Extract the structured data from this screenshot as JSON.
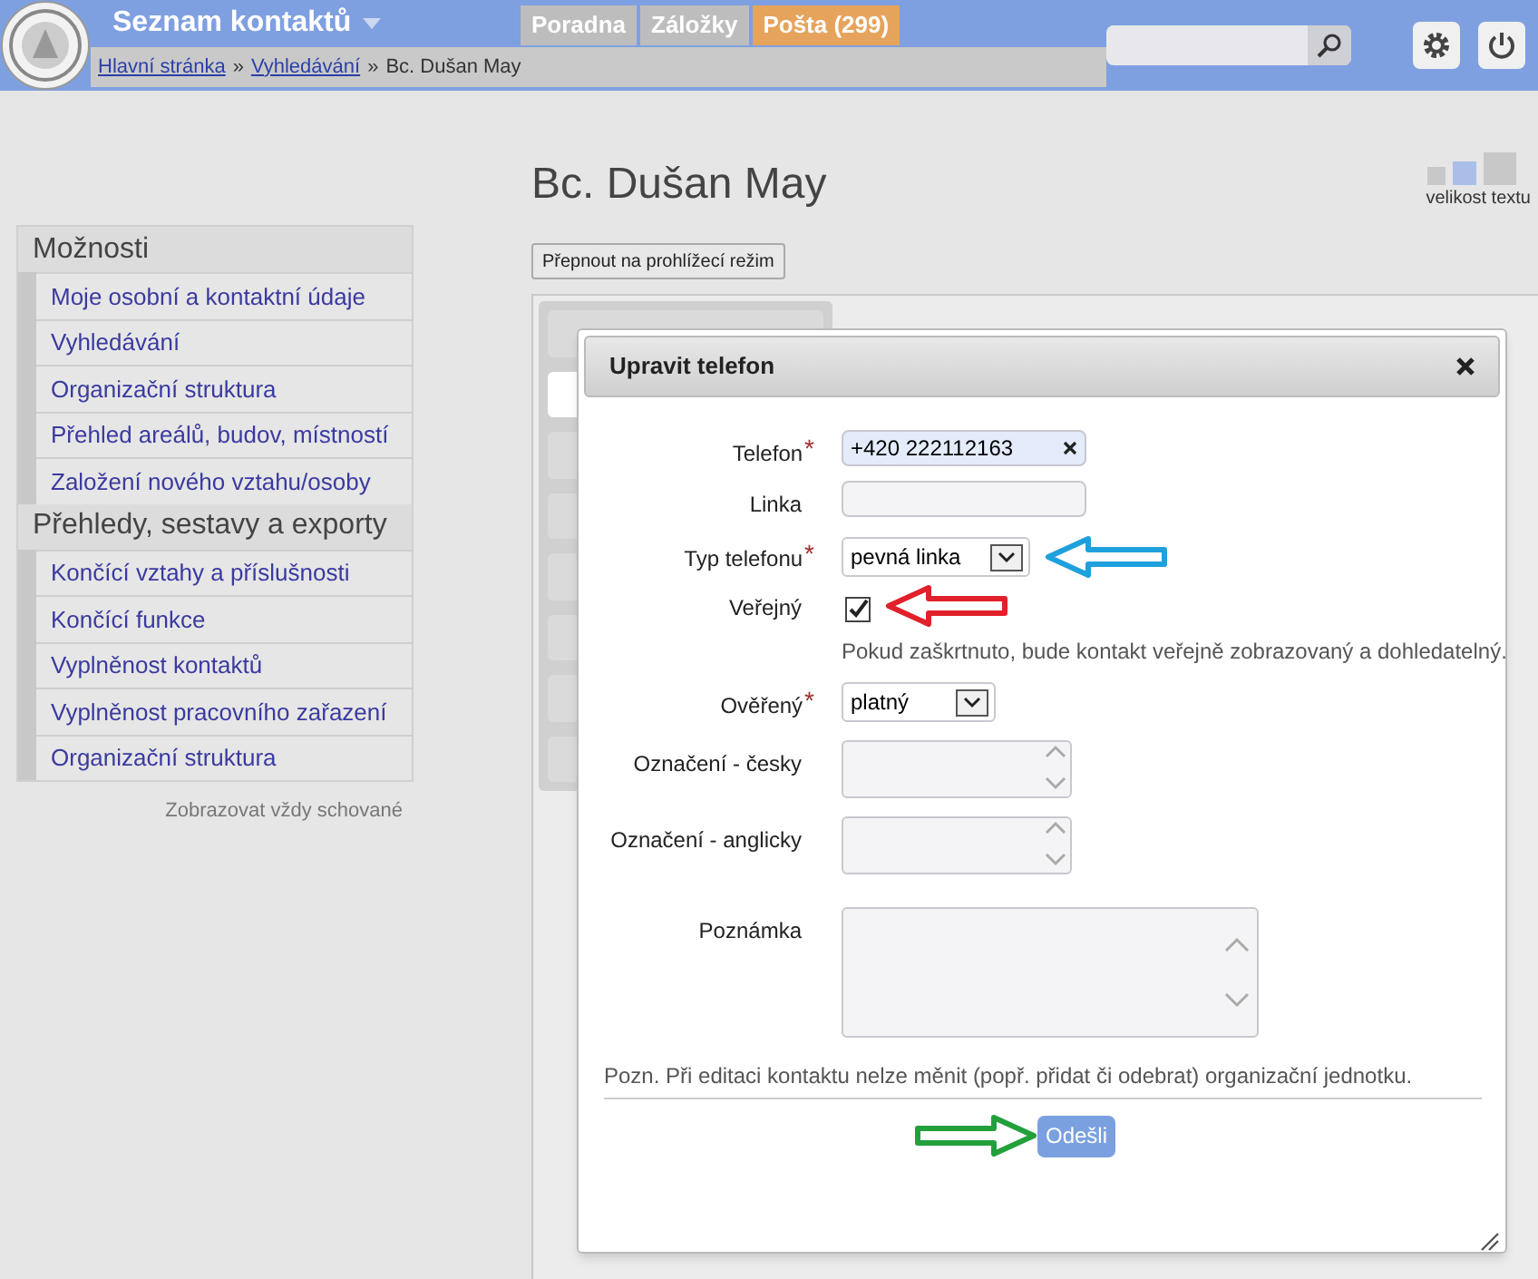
{
  "header": {
    "app_title": "Seznam kontaktů",
    "tabs": [
      {
        "label": "Poradna",
        "color": "#bdbdbd"
      },
      {
        "label": "Záložky",
        "color": "#bdbdbd"
      },
      {
        "label": "Pošta (299)",
        "color": "#e6a35c"
      }
    ],
    "breadcrumb": [
      {
        "label": "Hlavní stránka",
        "link": true
      },
      {
        "label": "»",
        "link": false
      },
      {
        "label": "Vyhledávání",
        "link": true
      },
      {
        "label": "»",
        "link": false
      },
      {
        "label": "Bc. Dušan May",
        "link": false
      }
    ]
  },
  "page": {
    "title": "Bc. Dušan May",
    "text_size_label": "velikost textu",
    "mode_button": "Přepnout na prohlížecí režim"
  },
  "sidebar": {
    "sections": [
      {
        "heading": "Možnosti",
        "items": [
          "Moje osobní a kontaktní údaje",
          "Vyhledávání",
          "Organizační struktura",
          "Přehled areálů, budov, místností",
          "Založení nového vztahu/osoby"
        ]
      },
      {
        "heading": "Přehledy, sestavy a exporty",
        "items": [
          "Končící vztahy a příslušnosti",
          "Končící funkce",
          "Vyplněnost kontaktů",
          "Vyplněnost pracovního zařazení",
          "Organizační struktura"
        ]
      }
    ],
    "footer": "Zobrazovat vždy schované"
  },
  "dialog": {
    "title": "Upravit telefon",
    "fields": [
      {
        "kind": "text",
        "label": "Telefon",
        "required_mark": "*",
        "value": "+420 222112163",
        "clearable": true
      },
      {
        "kind": "text",
        "label": "Linka"
      },
      {
        "kind": "select",
        "label": "Typ telefonu",
        "required_mark": "*",
        "value": "pevná linka",
        "annotation_arrow": {
          "color": "#1ea0dc"
        }
      },
      {
        "kind": "checkbox",
        "label": "Veřejný",
        "checked": true,
        "annotation_arrow": {
          "color": "#e0202a"
        },
        "hint": "Pokud zaškrtnuto, bude kontakt veřejně zobrazovaný a dohledatelný."
      },
      {
        "kind": "select",
        "label": "Ověřený",
        "required_mark": "*",
        "value": "platný"
      },
      {
        "kind": "textarea",
        "label": "Označení - česky"
      },
      {
        "kind": "textarea",
        "label": "Označení - anglicky"
      },
      {
        "kind": "note",
        "label": "Poznámka"
      }
    ],
    "note": "Pozn. Při editaci kontaktu nelze měnit (popř. přidat či odebrat) organizační jednotku.",
    "submit": "Odešli",
    "submit_annotation_arrow": {
      "color": "#22a03c"
    }
  }
}
